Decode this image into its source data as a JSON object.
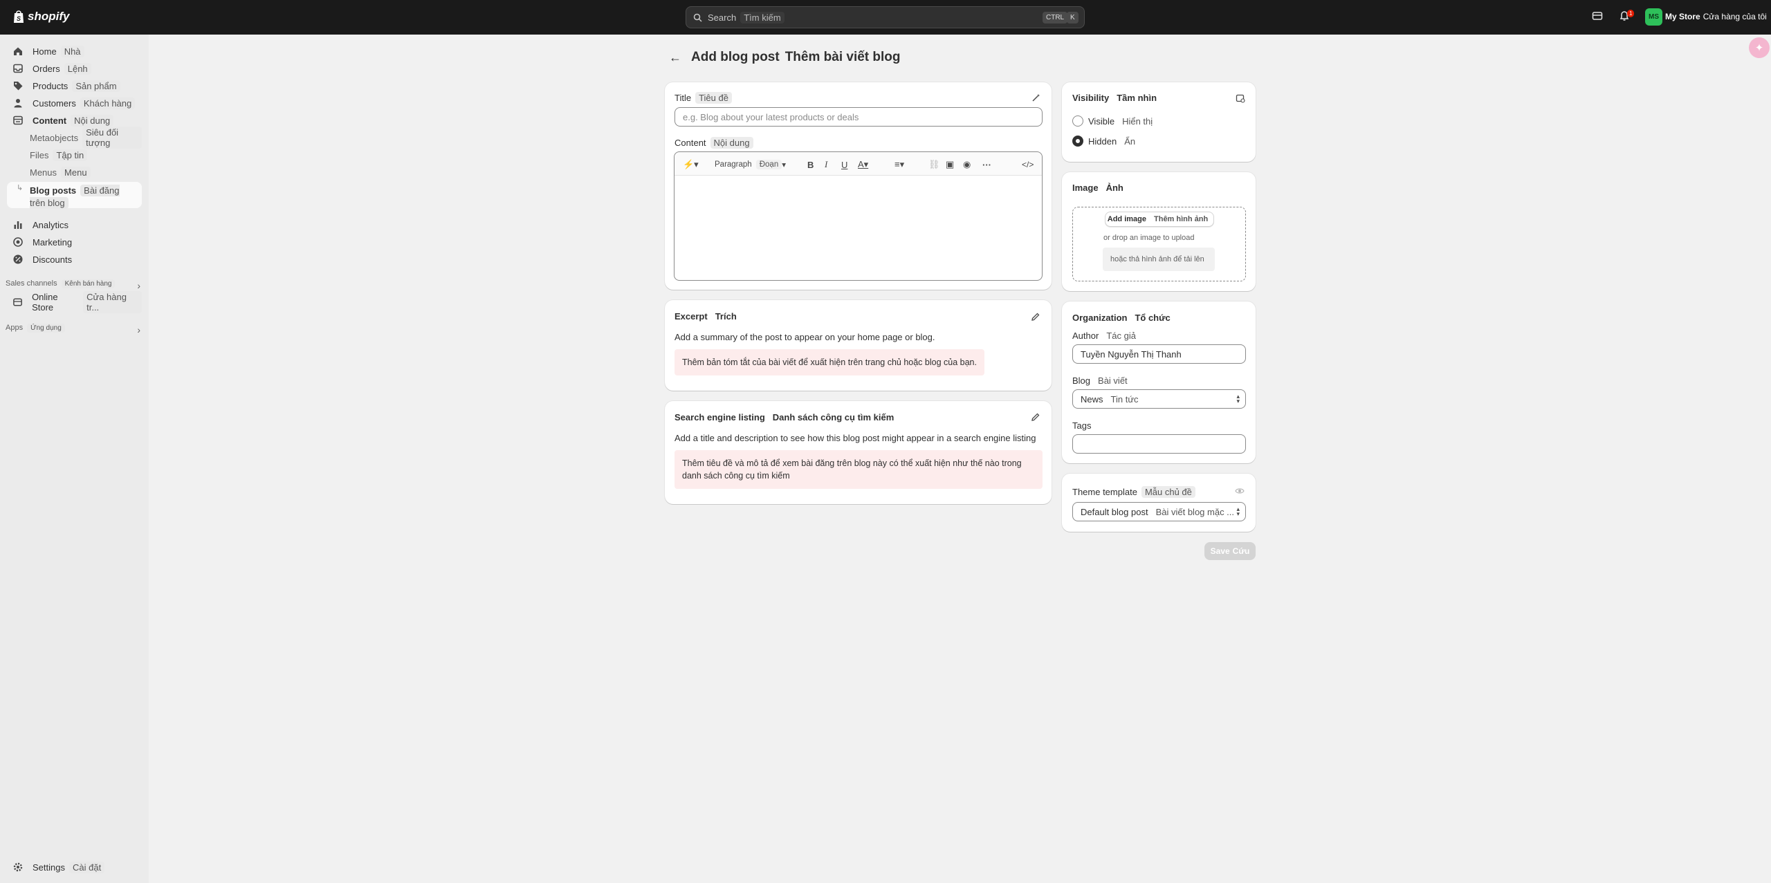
{
  "topbar": {
    "brand": "shopify",
    "search_placeholder": "Search",
    "search_placeholder_tr": "Tìm kiếm",
    "kbd_ctrl": "CTRL",
    "kbd_k": "K",
    "notification_count": "1",
    "avatar_initials": "MS",
    "store_name": "My Store",
    "store_name_tr": "Cửa hàng của tôi"
  },
  "sidebar": {
    "home": "Home",
    "home_tr": "Nhà",
    "orders": "Orders",
    "orders_tr": "Lệnh",
    "products": "Products",
    "products_tr": "Sản phẩm",
    "customers": "Customers",
    "customers_tr": "Khách hàng",
    "content": "Content",
    "content_tr": "Nội dung",
    "metaobjects": "Metaobjects",
    "metaobjects_tr": "Siêu đối tượng",
    "files": "Files",
    "files_tr": "Tập tin",
    "menus": "Menus",
    "menus_tr": "Menu",
    "blog_posts": "Blog posts",
    "blog_posts_tr": "Bài đăng trên blog",
    "analytics": "Analytics",
    "marketing": "Marketing",
    "discounts": "Discounts",
    "sales_channels": "Sales channels",
    "sales_channels_tr": "Kênh bán hàng",
    "online_store": "Online Store",
    "online_store_tr": "Cửa hàng tr...",
    "apps": "Apps",
    "apps_tr": "Ứng dụng",
    "settings": "Settings",
    "settings_tr": "Cài đặt"
  },
  "page": {
    "title": "Add blog post",
    "title_tr": "Thêm bài viết blog"
  },
  "main": {
    "title_label": "Title",
    "title_label_tr": "Tiêu đề",
    "title_placeholder": "e.g. Blog about your latest products or deals",
    "content_label": "Content",
    "content_label_tr": "Nội dung",
    "paragraph": "Paragraph",
    "paragraph_tr": "Đoạn",
    "excerpt_title": "Excerpt",
    "excerpt_title_tr": "Trích",
    "excerpt_desc": "Add a summary of the post to appear on your home page or blog.",
    "excerpt_desc_tr": "Thêm bản tóm tắt của bài viết để xuất hiện trên trang chủ hoặc blog của bạn.",
    "seo_title": "Search engine listing",
    "seo_title_tr": "Danh sách công cụ tìm kiếm",
    "seo_desc": "Add a title and description to see how this blog post might appear in a search engine listing",
    "seo_desc_tr": "Thêm tiêu đề và mô tả để xem bài đăng trên blog này có thể xuất hiện như thế nào trong danh sách công cụ tìm kiếm"
  },
  "side": {
    "visibility": "Visibility",
    "visibility_tr": "Tầm nhìn",
    "visible": "Visible",
    "visible_tr": "Hiển thị",
    "hidden": "Hidden",
    "hidden_tr": "Ẩn",
    "image": "Image",
    "image_tr": "Ảnh",
    "add_image": "Add image",
    "add_image_tr": "Thêm hình ảnh",
    "drop_text": "or drop an image to upload",
    "drop_text_tr": "hoặc thả hình ảnh để tải lên",
    "organization": "Organization",
    "organization_tr": "Tổ chức",
    "author": "Author",
    "author_tr": "Tác giả",
    "author_value": "Tuyền Nguyễn Thị Thanh",
    "blog": "Blog",
    "blog_tr": "Bài viết",
    "blog_value": "News",
    "blog_value_tr": "Tin tức",
    "tags": "Tags",
    "theme_template": "Theme template",
    "theme_template_tr": "Mẫu chủ đề",
    "theme_value": "Default blog post",
    "theme_value_tr": "Bài viết blog mặc ...",
    "save": "Save",
    "save_tr": "Cứu"
  }
}
